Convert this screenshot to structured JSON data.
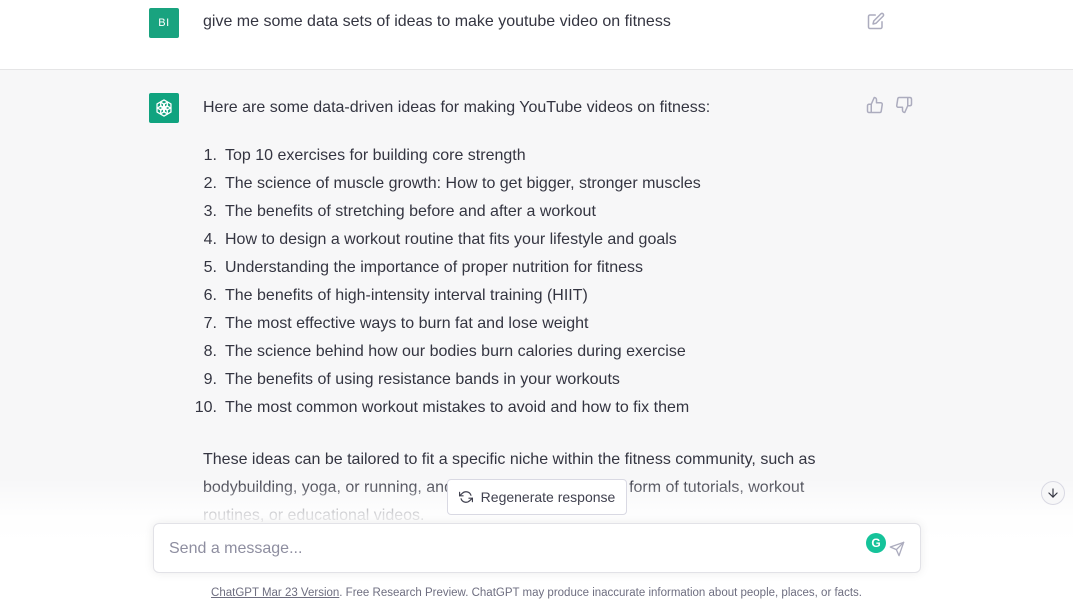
{
  "user_message": {
    "avatar_initials": "BI",
    "text": "give me some data sets of ideas to make youtube video on fitness"
  },
  "assistant_message": {
    "intro": "Here are some data-driven ideas for making YouTube videos on fitness:",
    "ideas": [
      {
        "num": "1.",
        "text": "Top 10 exercises for building core strength"
      },
      {
        "num": "2.",
        "text": "The science of muscle growth: How to get bigger, stronger muscles"
      },
      {
        "num": "3.",
        "text": "The benefits of stretching before and after a workout"
      },
      {
        "num": "4.",
        "text": "How to design a workout routine that fits your lifestyle and goals"
      },
      {
        "num": "5.",
        "text": "Understanding the importance of proper nutrition for fitness"
      },
      {
        "num": "6.",
        "text": "The benefits of high-intensity interval training (HIIT)"
      },
      {
        "num": "7.",
        "text": "The most effective ways to burn fat and lose weight"
      },
      {
        "num": "8.",
        "text": "The science behind how our bodies burn calories during exercise"
      },
      {
        "num": "9.",
        "text": "The benefits of using resistance bands in your workouts"
      },
      {
        "num": "10.",
        "text": "The most common workout mistakes to avoid and how to fix them"
      }
    ],
    "outro": "These ideas can be tailored to fit a specific niche within the fitness community, such as bodybuilding, yoga, or running, and can be presented in the form of tutorials, workout routines, or educational videos."
  },
  "regenerate_label": "Regenerate response",
  "composer": {
    "placeholder": "Send a message...",
    "grammarly_letter": "G"
  },
  "footer": {
    "version_link": "ChatGPT Mar 23 Version",
    "disclaimer": ". Free Research Preview. ChatGPT may produce inaccurate information about people, places, or facts."
  },
  "icons": {
    "edit": "edit-icon",
    "thumbs_up": "thumbs-up-icon",
    "thumbs_down": "thumbs-down-icon",
    "regenerate": "refresh-icon",
    "scroll_down": "arrow-down-icon",
    "send": "send-icon",
    "bot_logo": "openai-logo-icon"
  },
  "colors": {
    "brand_green": "#10a37f",
    "user_avatar": "#19a37f",
    "text": "#343541",
    "assistant_bg": "#f7f7f8"
  }
}
